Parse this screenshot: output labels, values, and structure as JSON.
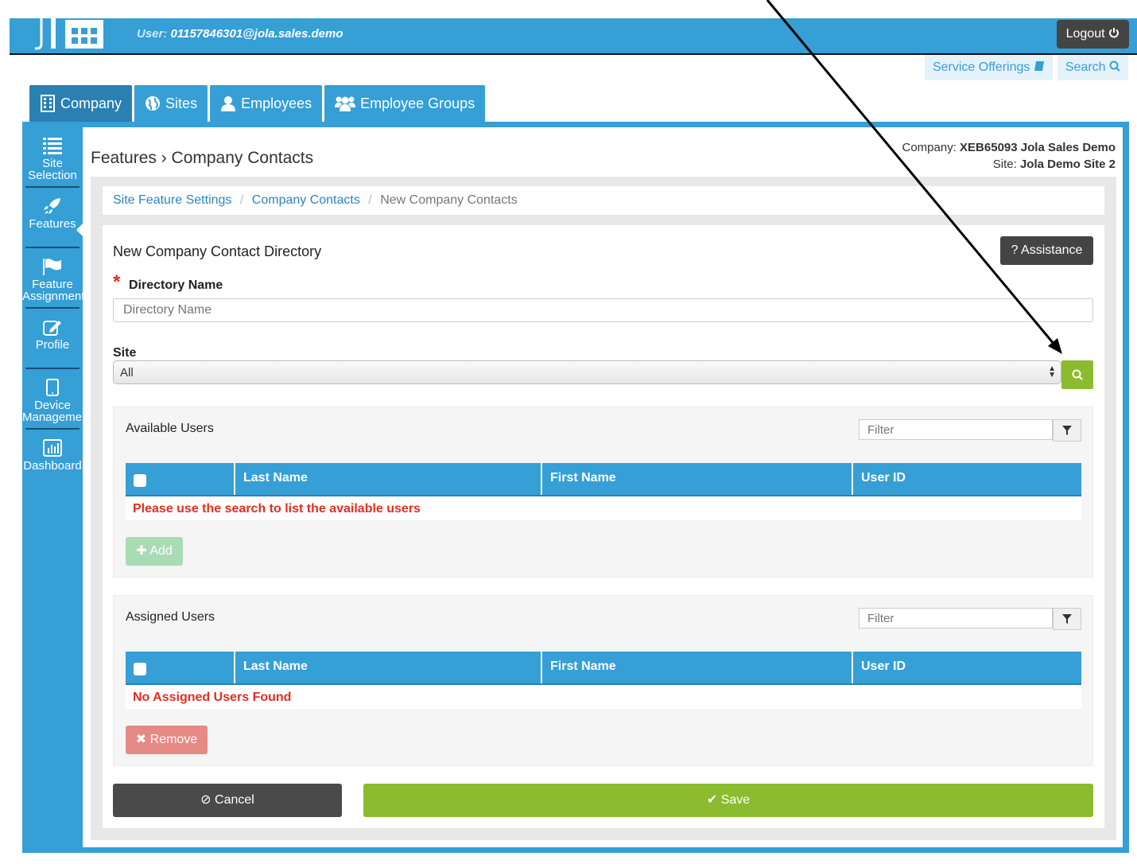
{
  "header": {
    "user_label": "User:",
    "user_value": "01157846301@jola.sales.demo",
    "logout_label": "Logout"
  },
  "toplinks": {
    "service_offerings": "Service Offerings",
    "search": "Search"
  },
  "tabs": [
    {
      "label": "Company",
      "icon": "building-icon",
      "active": true
    },
    {
      "label": "Sites",
      "icon": "globe-icon"
    },
    {
      "label": "Employees",
      "icon": "user-icon"
    },
    {
      "label": "Employee Groups",
      "icon": "users-icon"
    }
  ],
  "sidebar": {
    "items": [
      {
        "line1": "Site",
        "line2": "Selection",
        "icon": "list-icon"
      },
      {
        "line1": "Features",
        "line2": "",
        "icon": "rocket-icon",
        "active": true
      },
      {
        "line1": "Feature",
        "line2": "Assignment",
        "icon": "flag-icon"
      },
      {
        "line1": "Profile",
        "line2": "",
        "icon": "edit-icon"
      },
      {
        "line1": "Device",
        "line2": "Management",
        "icon": "tablet-icon"
      },
      {
        "line1": "Dashboard",
        "line2": "",
        "icon": "chart-icon"
      }
    ]
  },
  "page": {
    "title": "Features › Company Contacts",
    "company_label": "Company:",
    "company_value": "XEB65093 Jola Sales Demo",
    "site_label": "Site:",
    "site_value": "Jola Demo Site 2"
  },
  "breadcrumb": {
    "item1": "Site Feature Settings",
    "item2": "Company Contacts",
    "item3": "New Company Contacts"
  },
  "form": {
    "title": "New Company Contact Directory",
    "assistance_label": "? Assistance",
    "directory_label": "Directory Name",
    "directory_placeholder": "Directory Name",
    "site_label": "Site",
    "site_selected": "All"
  },
  "available": {
    "title": "Available Users",
    "filter_placeholder": "Filter",
    "columns": [
      "Last Name",
      "First Name",
      "User ID"
    ],
    "message": "Please use the search to list the available users",
    "add_label": "Add"
  },
  "assigned": {
    "title": "Assigned Users",
    "filter_placeholder": "Filter",
    "columns": [
      "Last Name",
      "First Name",
      "User ID"
    ],
    "message": "No Assigned Users Found",
    "remove_label": "Remove"
  },
  "actions": {
    "cancel_label": "Cancel",
    "save_label": "Save"
  },
  "colors": {
    "primary": "#359fd6",
    "success": "#8bbc2f",
    "danger": "#e0301e",
    "dark": "#444444"
  }
}
